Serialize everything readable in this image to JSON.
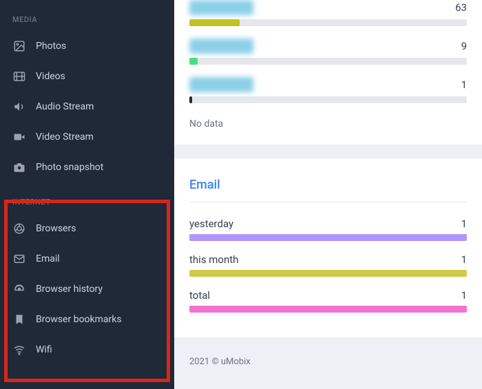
{
  "sidebar": {
    "sections": [
      {
        "header": "MEDIA",
        "items": [
          {
            "label": "Photos",
            "icon": "photo-icon"
          },
          {
            "label": "Videos",
            "icon": "film-icon"
          },
          {
            "label": "Audio Stream",
            "icon": "speaker-icon"
          },
          {
            "label": "Video Stream",
            "icon": "video-camera-icon"
          },
          {
            "label": "Photo snapshot",
            "icon": "camera-icon"
          }
        ]
      },
      {
        "header": "INTERNET",
        "items": [
          {
            "label": "Browsers",
            "icon": "chrome-icon"
          },
          {
            "label": "Email",
            "icon": "mail-icon"
          },
          {
            "label": "Browser history",
            "icon": "ie-icon"
          },
          {
            "label": "Browser bookmarks",
            "icon": "bookmark-icon"
          },
          {
            "label": "Wifi",
            "icon": "wifi-icon"
          }
        ]
      }
    ]
  },
  "top_card": {
    "rows": [
      {
        "label": "████████",
        "value": 63,
        "pct": 18,
        "color": "#c2c223"
      },
      {
        "label": "████████",
        "value": 9,
        "pct": 3,
        "color": "#4ade80"
      },
      {
        "label": "████████",
        "value": 1,
        "pct": 1,
        "color": "#1f2937"
      }
    ],
    "no_data": "No data"
  },
  "email_card": {
    "title": "Email",
    "rows": [
      {
        "label": "yesterday",
        "value": 1,
        "pct": 100,
        "color": "#b197fc"
      },
      {
        "label": "this month",
        "value": 1,
        "pct": 100,
        "color": "#d4c84a"
      },
      {
        "label": "total",
        "value": 1,
        "pct": 100,
        "color": "#f472d0"
      }
    ]
  },
  "footer": "2021 © uMobix"
}
